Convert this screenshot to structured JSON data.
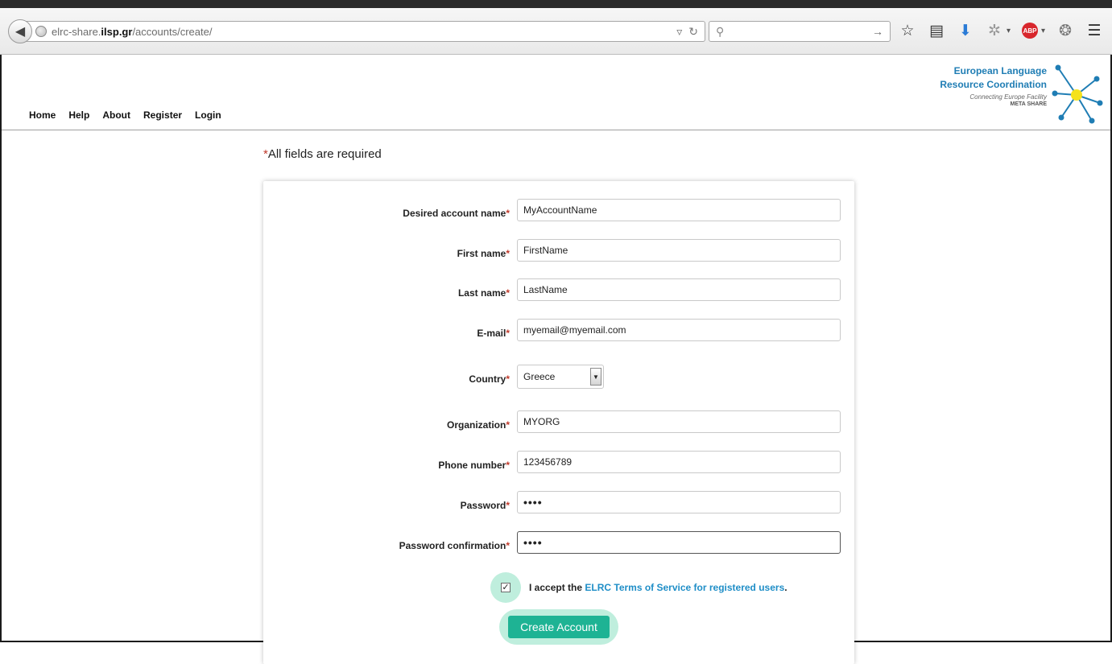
{
  "browser": {
    "url_prefix": "elrc-share.",
    "url_host": "ilsp.gr",
    "url_path": "/accounts/create/",
    "search_placeholder": ""
  },
  "nav": {
    "items": [
      "Home",
      "Help",
      "About",
      "Register",
      "Login"
    ]
  },
  "logo": {
    "line1": "European Language",
    "line2": "Resource Coordination",
    "line3": "Connecting Europe Facility",
    "line4": "META SHARE"
  },
  "form": {
    "required_note_star": "*",
    "required_note": "All fields are required",
    "fields": [
      {
        "label": "Desired account name",
        "value": "MyAccountName"
      },
      {
        "label": "First name",
        "value": "FirstName"
      },
      {
        "label": "Last name",
        "value": "LastName"
      },
      {
        "label": "E-mail",
        "value": "myemail@myemail.com"
      },
      {
        "label": "Country",
        "value": "Greece"
      },
      {
        "label": "Organization",
        "value": "MYORG"
      },
      {
        "label": "Phone number",
        "value": "123456789"
      },
      {
        "label": "Password",
        "value": "••••"
      },
      {
        "label": "Password confirmation",
        "value": "••••"
      }
    ],
    "required_star": "*",
    "terms_prefix": "I accept the",
    "terms_link": "ELRC Terms of Service for registered users",
    "terms_suffix": ".",
    "terms_checked": true,
    "submit_label": "Create Account"
  },
  "colors": {
    "accent": "#1eb394",
    "link": "#1f8ec7",
    "highlight": "#bfeedd",
    "required": "#c0392b"
  }
}
